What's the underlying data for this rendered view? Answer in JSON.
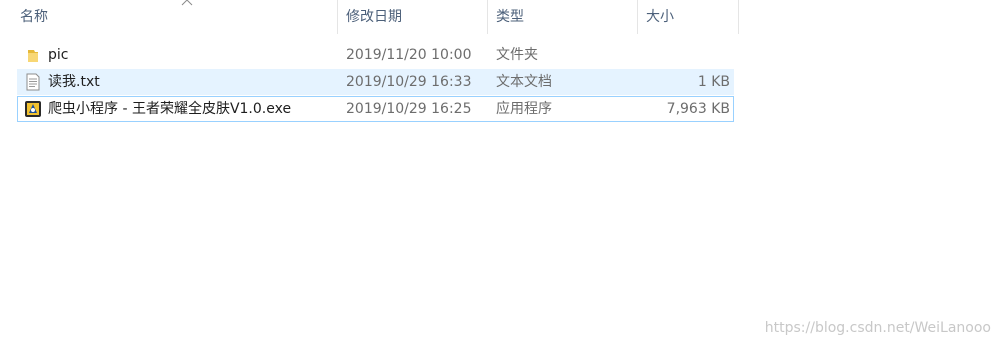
{
  "columns": {
    "name": "名称",
    "date": "修改日期",
    "type": "类型",
    "size": "大小"
  },
  "files": [
    {
      "name": "pic",
      "date": "2019/11/20 10:00",
      "type": "文件夹",
      "size": "",
      "icon": "folder-icon",
      "state": "normal"
    },
    {
      "name": "读我.txt",
      "date": "2019/10/29 16:33",
      "type": "文本文档",
      "size": "1 KB",
      "icon": "text-file-icon",
      "state": "hover"
    },
    {
      "name": "爬虫小程序 - 王者荣耀全皮肤V1.0.exe",
      "date": "2019/10/29 16:25",
      "type": "应用程序",
      "size": "7,963 KB",
      "icon": "app-exe-icon",
      "state": "selected"
    }
  ],
  "watermark": "https://blog.csdn.net/WeiLanooo",
  "colors": {
    "header_text": "#4c607a",
    "hover_bg": "#e5f3ff",
    "selected_border": "#99d1ff",
    "folder": "#f8d775"
  }
}
